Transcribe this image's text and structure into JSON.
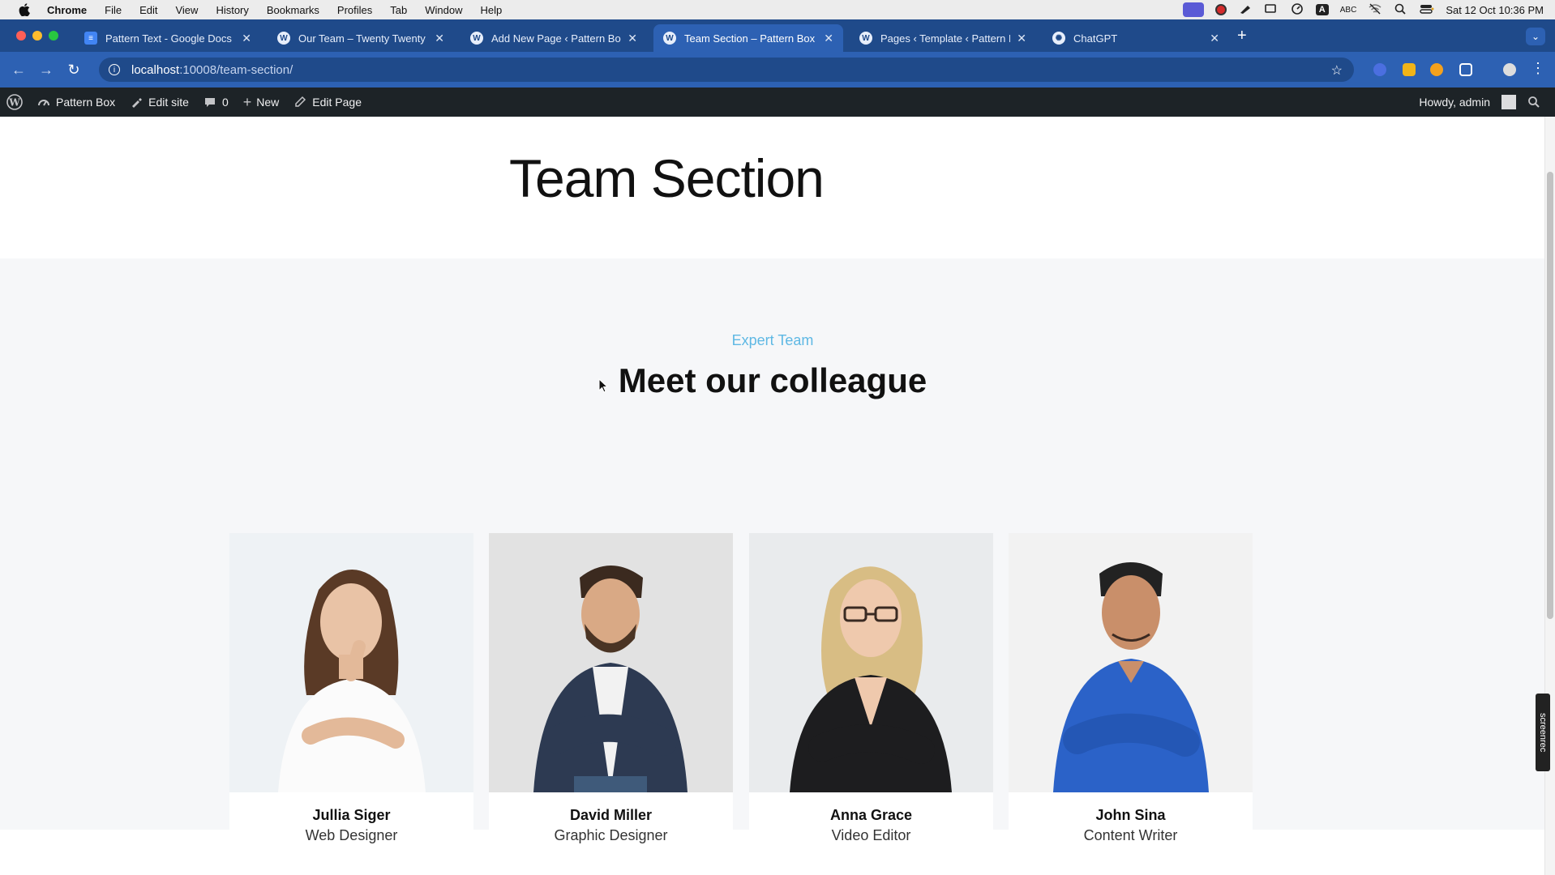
{
  "menubar": {
    "app": "Chrome",
    "items": [
      "File",
      "Edit",
      "View",
      "History",
      "Bookmarks",
      "Profiles",
      "Tab",
      "Window",
      "Help"
    ],
    "abc_label": "ABC",
    "datetime": "Sat 12 Oct  10:36 PM"
  },
  "tabs": [
    {
      "title": "Pattern Text - Google Docs",
      "icon": "google-docs-icon",
      "active": false
    },
    {
      "title": "Our Team – Twenty Twenty F",
      "icon": "wordpress-icon",
      "active": false
    },
    {
      "title": "Add New Page ‹ Pattern Box",
      "icon": "wordpress-icon",
      "active": false
    },
    {
      "title": "Team Section – Pattern Box",
      "icon": "wordpress-icon",
      "active": true
    },
    {
      "title": "Pages ‹ Template ‹ Pattern B",
      "icon": "wordpress-icon",
      "active": false
    },
    {
      "title": "ChatGPT",
      "icon": "chatgpt-icon",
      "active": false
    }
  ],
  "url": {
    "host": "localhost",
    "path": ":10008/team-section/"
  },
  "adminbar": {
    "site": "Pattern Box",
    "edit_site": "Edit site",
    "comments": "0",
    "new": "New",
    "edit_page": "Edit Page",
    "howdy": "Howdy, admin"
  },
  "page": {
    "title": "Team Section",
    "eyebrow": "Expert Team",
    "heading": "Meet our colleague"
  },
  "team": [
    {
      "name": "Jullia Siger",
      "role": "Web Designer"
    },
    {
      "name": "David Miller",
      "role": "Graphic Designer"
    },
    {
      "name": "Anna Grace",
      "role": "Video Editor"
    },
    {
      "name": "John Sina",
      "role": "Content Writer"
    }
  ],
  "screenrec_label": "screenrec",
  "colors": {
    "tabstrip": "#1f4a8a",
    "toolbar": "#2d61b3",
    "adminbar": "#1d2327",
    "accent_eyebrow": "#5eb8e4",
    "band": "#f6f7f9"
  }
}
